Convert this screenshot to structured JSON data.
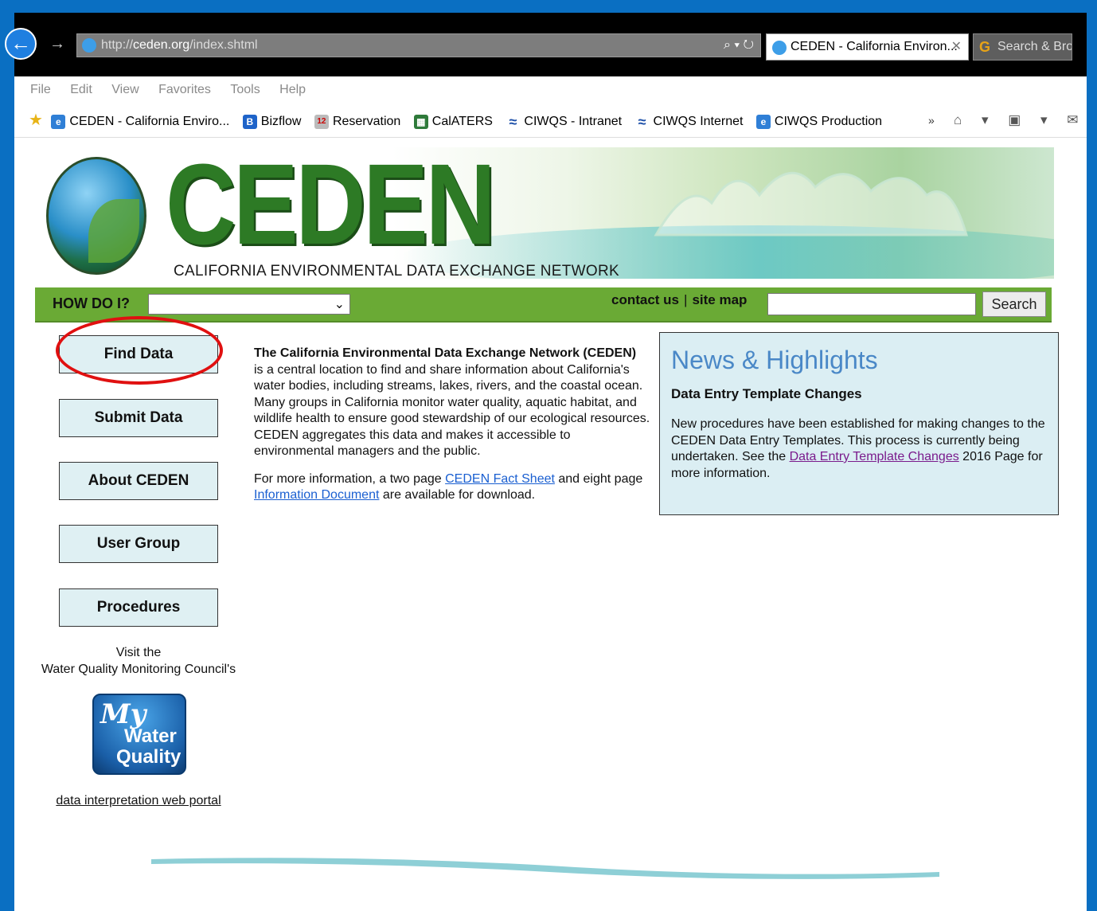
{
  "browser": {
    "url_prefix": "http://",
    "url_host": "ceden.org",
    "url_path": "/index.shtml",
    "search_refresh": "⌕ ▾ ↻",
    "active_tab": "CEDEN - California Environ...",
    "tab_close": "✕",
    "inactive_tab": "Search & Bro",
    "menu": [
      "File",
      "Edit",
      "View",
      "Favorites",
      "Tools",
      "Help"
    ],
    "favorites": [
      {
        "label": "CEDEN - California Enviro...",
        "icon": "ie-page-icon",
        "color": "#2f7fd6",
        "glyph": "e"
      },
      {
        "label": "Bizflow",
        "icon": "bizflow-icon",
        "color": "#1e63c9",
        "glyph": "B"
      },
      {
        "label": "Reservation",
        "icon": "calendar-icon",
        "color": "#b8b8b8",
        "glyph": "12"
      },
      {
        "label": "CalATERS",
        "icon": "calaters-icon",
        "color": "#2e7a3a",
        "glyph": "▦"
      },
      {
        "label": "CIWQS - Intranet",
        "icon": "wave-icon",
        "color": "#ffffff",
        "glyph": "≈"
      },
      {
        "label": "CIWQS Internet",
        "icon": "wave-icon",
        "color": "#ffffff",
        "glyph": "≈"
      },
      {
        "label": "CIWQS Production",
        "icon": "ie-page-icon",
        "color": "#2f7fd6",
        "glyph": "e"
      }
    ],
    "chevron": "»",
    "tool_icons": "⌂ ▾ ▣ ▾ ✉"
  },
  "site": {
    "logo_word": "CEDEN",
    "logo_subtitle": "CALIFORNIA ENVIRONMENTAL DATA EXCHANGE NETWORK",
    "nav": {
      "howdoi_label": "HOW DO I?",
      "select_value": "",
      "contact": "contact us",
      "separator": "|",
      "sitemap": "site map",
      "search_value": "",
      "search_button": "Search"
    },
    "sidebar": {
      "buttons": [
        "Find Data",
        "Submit Data",
        "About CEDEN",
        "User Group",
        "Procedures"
      ],
      "visit_line1": "Visit the",
      "visit_line2": "Water Quality Monitoring Council's",
      "logo_my": "My",
      "logo_water": "Water",
      "logo_quality": "Quality",
      "portal_link": "data interpretation web portal"
    },
    "main": {
      "title": "The California Environmental Data Exchange Network (CEDEN)",
      "body": "is a central location to find and share information about California's water bodies, including streams, lakes, rivers, and the coastal ocean. Many groups in California monitor water quality, aquatic habitat, and wildlife health to ensure good stewardship of our ecological resources. CEDEN aggregates this data and makes it accessible to environmental managers and the public.",
      "more_prefix": "For more information, a two page ",
      "fact_sheet_link": "CEDEN Fact Sheet",
      "more_middle": " and eight page ",
      "info_doc_link": "Information Document",
      "more_suffix": " are available for download."
    },
    "news": {
      "title": "News & Highlights",
      "subtitle": "Data Entry Template Changes",
      "body_prefix": "New procedures have been established for making changes to the CEDEN Data Entry Templates. This process is currently being undertaken. See the ",
      "link": "Data Entry Template Changes",
      "body_suffix": " 2016 Page for more information."
    }
  },
  "colors": {
    "frame": "#0a6fc2",
    "nav_green": "#6aaa35",
    "logo_green": "#2d7a25",
    "button_bg": "#dff0f3",
    "highlight": "#e01010",
    "news_title": "#4a88c7"
  }
}
